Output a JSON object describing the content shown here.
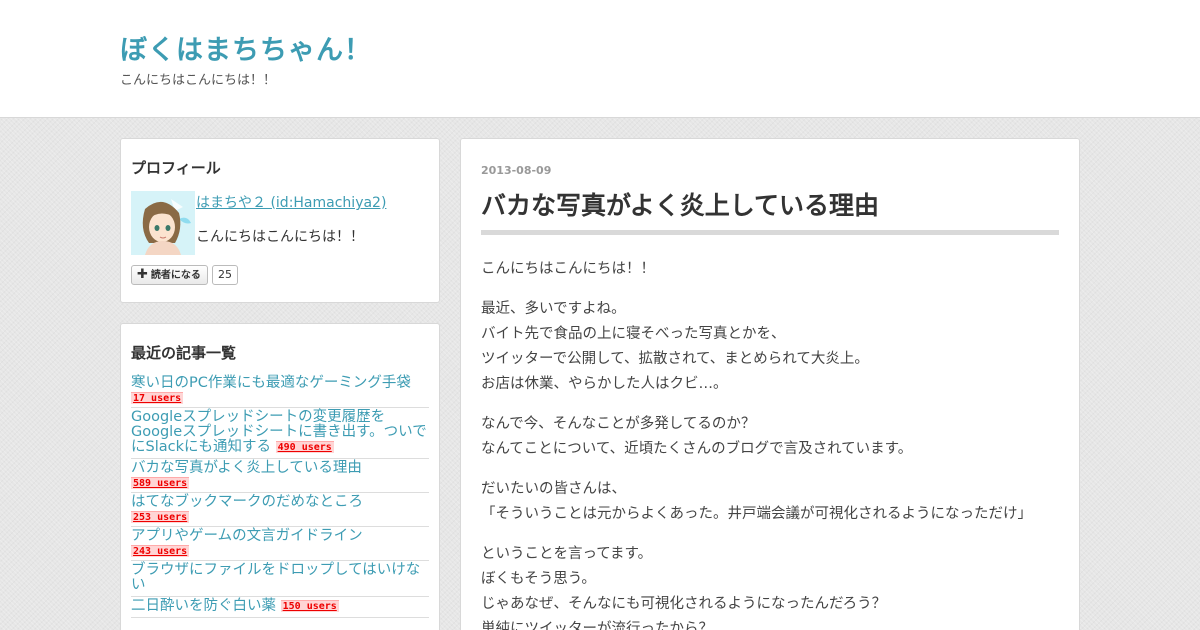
{
  "header": {
    "blog_title": "ぼくはまちちゃん！",
    "blog_description": "こんにちはこんにちは！！"
  },
  "profile": {
    "heading": "プロフィール",
    "name": "はまちや２ (id:Hamachiya2)",
    "intro": "こんにちはこんにちは！！",
    "subscribe_label": "読者になる",
    "subscriber_count": "25",
    "icons": {
      "subscribe": "plus-icon"
    }
  },
  "recent": {
    "heading": "最近の記事一覧",
    "items": [
      {
        "title": "寒い日のPC作業にも最適なゲーミング手袋",
        "users": "17 users"
      },
      {
        "title": "Googleスプレッドシートの変更履歴をGoogleスプレッドシートに書き出す。ついでにSlackにも通知する",
        "users": "490 users"
      },
      {
        "title": "バカな写真がよく炎上している理由",
        "users": "589 users"
      },
      {
        "title": "はてなブックマークのだめなところ",
        "users": "253 users"
      },
      {
        "title": "アプリやゲームの文言ガイドライン",
        "users": "243 users"
      },
      {
        "title": "ブラウザにファイルをドロップしてはいけない",
        "users": ""
      },
      {
        "title": "二日酔いを防ぐ白い薬",
        "users": "150 users"
      }
    ]
  },
  "article": {
    "date": "2013-08-09",
    "title": "バカな写真がよく炎上している理由",
    "paragraphs": [
      [
        "こんにちはこんにちは！！"
      ],
      [
        "最近、多いですよね。",
        "バイト先で食品の上に寝そべった写真とかを、",
        "ツイッターで公開して、拡散されて、まとめられて大炎上。",
        "お店は休業、やらかした人はクビ…。"
      ],
      [
        "なんで今、そんなことが多発してるのか？",
        "なんてことについて、近頃たくさんのブログで言及されています。"
      ],
      [
        "だいたいの皆さんは、",
        "「そういうことは元からよくあった。井戸端会議が可視化されるようになっただけ」"
      ],
      [
        "ということを言ってます。",
        "ぼくもそう思う。",
        "じゃあなぜ、そんなにも可視化されるようになったんだろう？",
        "単純にツイッターが流行ったから？"
      ]
    ]
  },
  "colors": {
    "accent": "#3d9cb3",
    "badge_bg": "#ffd5d5",
    "badge_text": "#ee0000"
  }
}
